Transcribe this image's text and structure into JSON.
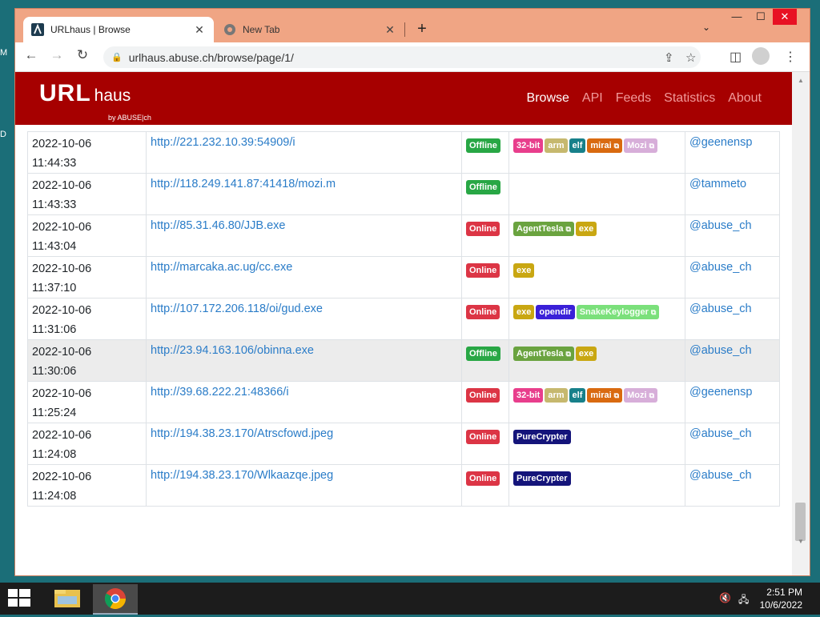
{
  "desktop": {
    "labels": [
      "M",
      "D"
    ]
  },
  "browser": {
    "tabs": [
      {
        "title": "URLhaus | Browse",
        "active": true
      },
      {
        "title": "New Tab",
        "active": false
      }
    ],
    "url": "urlhaus.abuse.ch/browse/page/1/"
  },
  "site": {
    "logo_main": "URL",
    "logo_sub": "haus",
    "logo_by": "by ABUSE|ch",
    "menu": [
      "Browse",
      "API",
      "Feeds",
      "Statistics",
      "About"
    ]
  },
  "colors": {
    "Online": "#dc3545",
    "Offline": "#28a745",
    "32-bit": "#e83e8c",
    "arm": "#c6b86e",
    "elf": "#17808a",
    "mirai": "#d96a10",
    "Mozi": "#d7aed9",
    "AgentTesla": "#6aa33f",
    "exe": "#c9a712",
    "opendir": "#3a20d8",
    "SnakeKeylogger": "#7be07b",
    "PureCrypter": "#14147a"
  },
  "rows": [
    {
      "date": "2022-10-06",
      "time": "11:44:33",
      "url": "http://221.232.10.39:54909/i",
      "status": "Offline",
      "tags": [
        {
          "t": "32-bit"
        },
        {
          "t": "arm"
        },
        {
          "t": "elf"
        },
        {
          "t": "mirai",
          "ext": true
        },
        {
          "t": "Mozi",
          "ext": true
        }
      ],
      "reporter": "@geenensp"
    },
    {
      "date": "2022-10-06",
      "time": "11:43:33",
      "url": "http://118.249.141.87:41418/mozi.m",
      "status": "Offline",
      "tags": [],
      "reporter": "@tammeto"
    },
    {
      "date": "2022-10-06",
      "time": "11:43:04",
      "url": "http://85.31.46.80/JJB.exe",
      "status": "Online",
      "tags": [
        {
          "t": "AgentTesla",
          "ext": true
        },
        {
          "t": "exe"
        }
      ],
      "reporter": "@abuse_ch"
    },
    {
      "date": "2022-10-06",
      "time": "11:37:10",
      "url": "http://marcaka.ac.ug/cc.exe",
      "status": "Online",
      "tags": [
        {
          "t": "exe"
        }
      ],
      "reporter": "@abuse_ch"
    },
    {
      "date": "2022-10-06",
      "time": "11:31:06",
      "url": "http://107.172.206.118/oi/gud.exe",
      "status": "Online",
      "tags": [
        {
          "t": "exe"
        },
        {
          "t": "opendir"
        },
        {
          "t": "SnakeKeylogger",
          "ext": true
        }
      ],
      "reporter": "@abuse_ch"
    },
    {
      "date": "2022-10-06",
      "time": "11:30:06",
      "url": "http://23.94.163.106/obinna.exe",
      "status": "Offline",
      "tags": [
        {
          "t": "AgentTesla",
          "ext": true
        },
        {
          "t": "exe"
        }
      ],
      "reporter": "@abuse_ch",
      "highlight": true
    },
    {
      "date": "2022-10-06",
      "time": "11:25:24",
      "url": "http://39.68.222.21:48366/i",
      "status": "Online",
      "tags": [
        {
          "t": "32-bit"
        },
        {
          "t": "arm"
        },
        {
          "t": "elf"
        },
        {
          "t": "mirai",
          "ext": true
        },
        {
          "t": "Mozi",
          "ext": true
        }
      ],
      "reporter": "@geenensp"
    },
    {
      "date": "2022-10-06",
      "time": "11:24:08",
      "url": "http://194.38.23.170/Atrscfowd.jpeg",
      "status": "Online",
      "tags": [
        {
          "t": "PureCrypter"
        }
      ],
      "reporter": "@abuse_ch"
    },
    {
      "date": "2022-10-06",
      "time": "11:24:08",
      "url": "http://194.38.23.170/Wlkaazqe.jpeg",
      "status": "Online",
      "tags": [
        {
          "t": "PureCrypter"
        }
      ],
      "reporter": "@abuse_ch"
    }
  ],
  "taskbar": {
    "time": "2:51 PM",
    "date": "10/6/2022"
  }
}
